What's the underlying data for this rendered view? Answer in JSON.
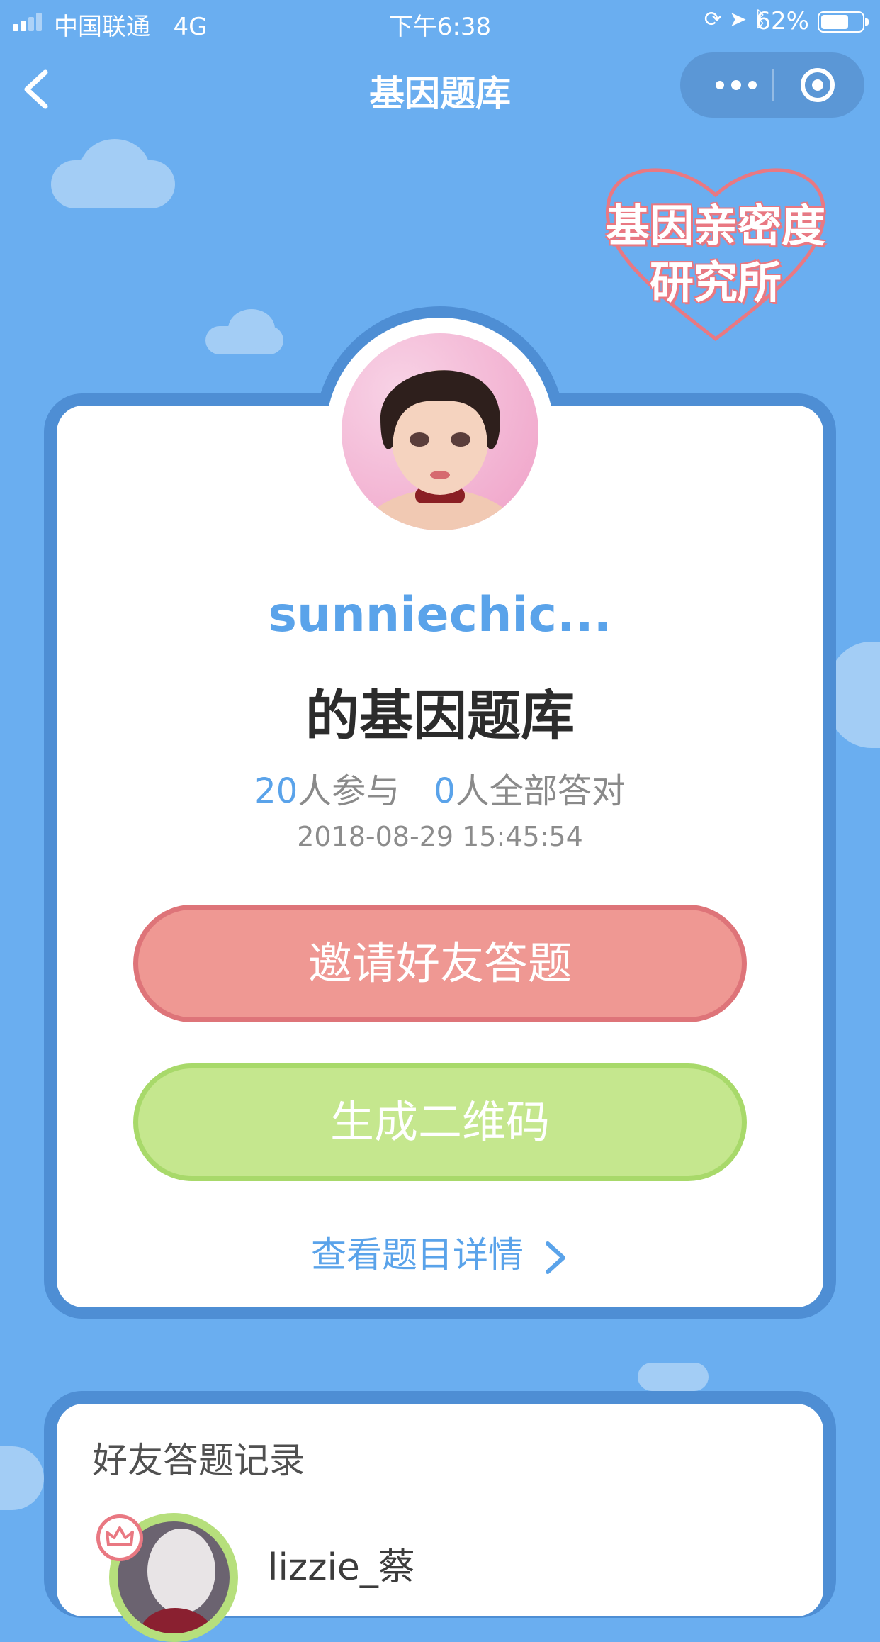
{
  "status_bar": {
    "carrier": "中国联通",
    "network": "4G",
    "time": "下午6:38",
    "battery": "62%",
    "battery_level": 0.62
  },
  "nav": {
    "title": "基因题库"
  },
  "logo": {
    "line1": "基因亲密度",
    "line2": "研究所"
  },
  "profile": {
    "username": "sunniechic...",
    "bank_title": "的基因题库",
    "participants_count": "20",
    "participants_label": "人参与",
    "all_correct_count": "0",
    "all_correct_label": "人全部答对",
    "timestamp": "2018-08-29 15:45:54"
  },
  "actions": {
    "invite_label": "邀请好友答题",
    "qr_label": "生成二维码",
    "detail_label": "查看题目详情"
  },
  "records": {
    "title": "好友答题记录",
    "items": [
      {
        "name": "lizzie_蔡"
      }
    ]
  },
  "colors": {
    "background": "#6aaef0",
    "card_border": "#4e8ed4",
    "accent_blue": "#5aa3ea",
    "invite_button": "#ef9893",
    "qr_button": "#c5e78e"
  }
}
